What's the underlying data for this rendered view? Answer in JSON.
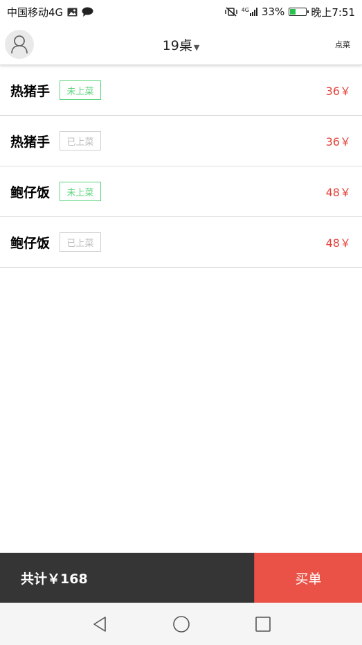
{
  "status_bar": {
    "carrier": "中国移动4G",
    "battery": "33%",
    "battery_level": 0.33,
    "time": "晚上7:51",
    "net_label": "4G",
    "left_icons": [
      "photo-icon",
      "chat-icon"
    ],
    "right_icons": [
      "mute-vibrate-icon",
      "signal-icon",
      "battery-icon"
    ]
  },
  "header": {
    "table_label": "19桌",
    "order_link": "点菜",
    "avatar_icon": "user-icon"
  },
  "orders": [
    {
      "name": "热猪手",
      "status": "未上菜",
      "state": "pending",
      "price": "36￥"
    },
    {
      "name": "热猪手",
      "status": "已上菜",
      "state": "served",
      "price": "36￥"
    },
    {
      "name": "鲍仔饭",
      "status": "未上菜",
      "state": "pending",
      "price": "48￥"
    },
    {
      "name": "鲍仔饭",
      "status": "已上菜",
      "state": "served",
      "price": "48￥"
    }
  ],
  "footer": {
    "total": "共计￥168",
    "checkout": "买单"
  },
  "colors": {
    "pending": "#5dd47c",
    "served": "#bdbdbd",
    "price": "#e4433a",
    "checkout_bg": "#ea5247",
    "total_bg": "#353535"
  },
  "nav": [
    "back-icon",
    "home-icon",
    "recents-icon"
  ]
}
